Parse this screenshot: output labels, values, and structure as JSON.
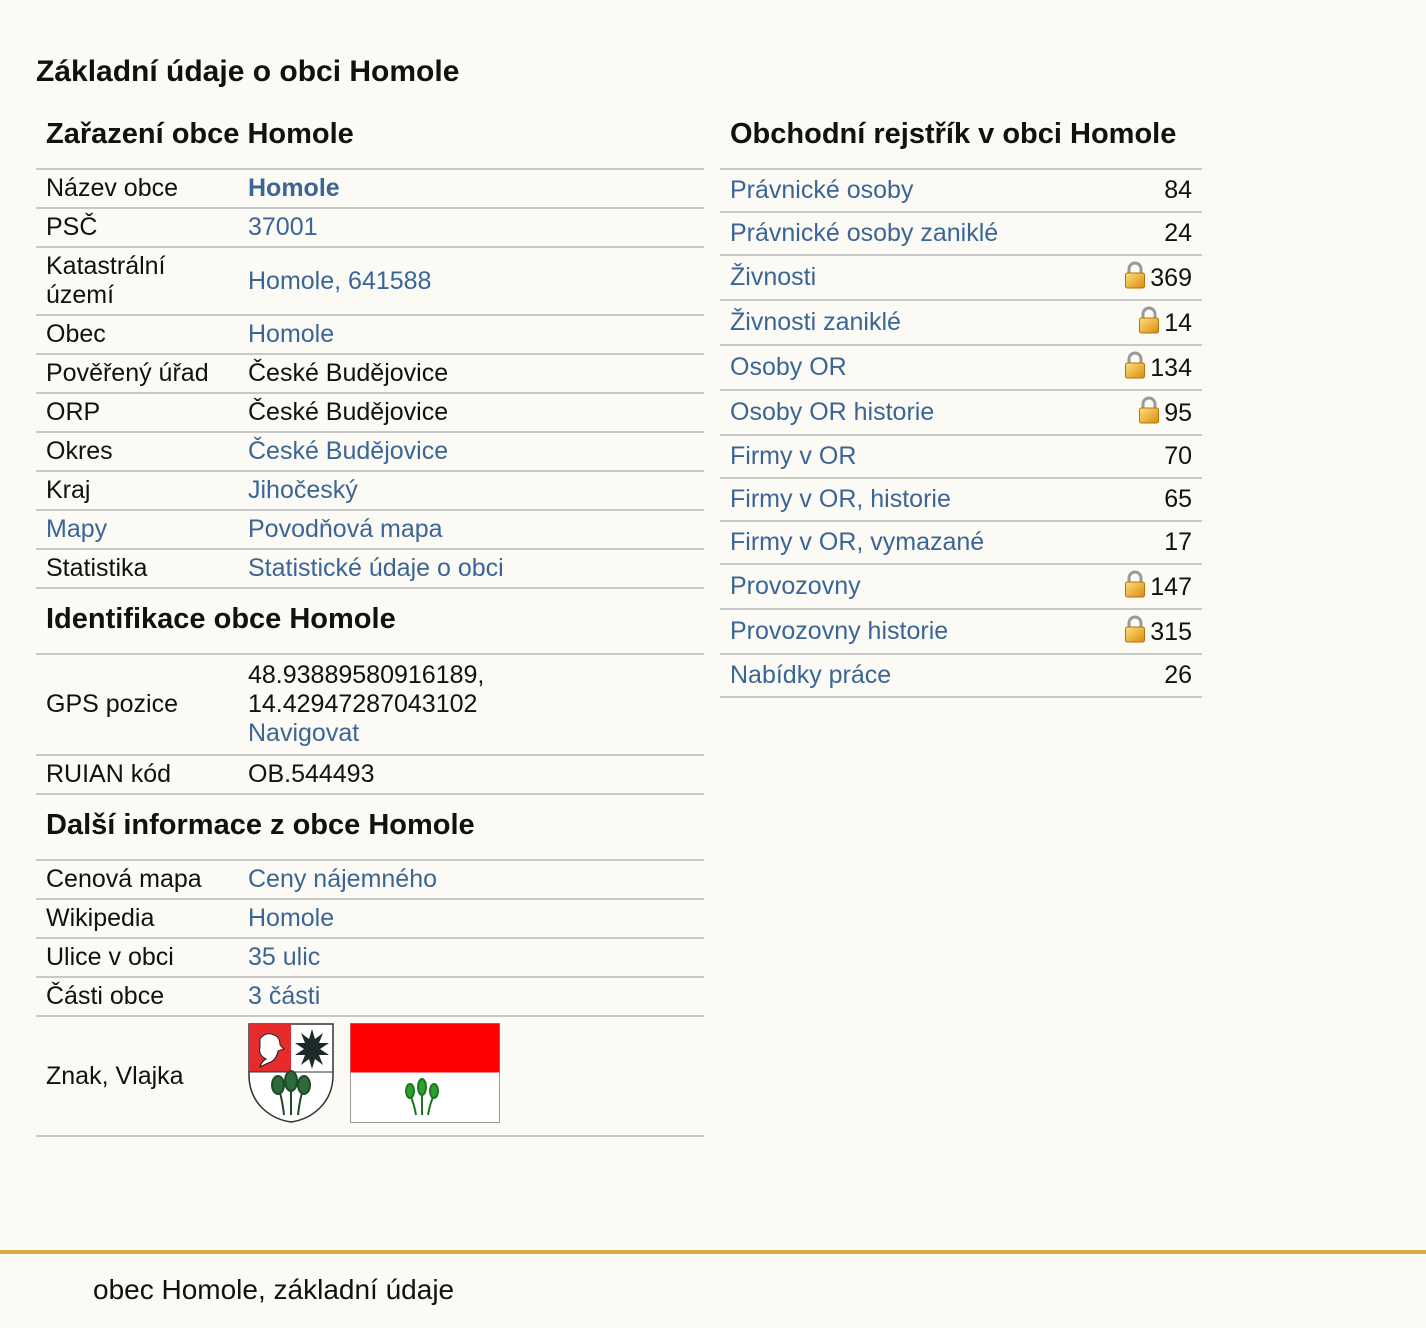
{
  "page_title": "Základní údaje o obci Homole",
  "zarazeni": {
    "heading": "Zařazení obce Homole",
    "rows": [
      {
        "key": "Název obce",
        "value": "Homole"
      },
      {
        "key": "PSČ",
        "value": "37001"
      },
      {
        "key": "Katastrální území",
        "value": "Homole, 641588"
      },
      {
        "key": "Obec",
        "value": "Homole"
      },
      {
        "key": "Pověřený úřad",
        "value": "České Budějovice"
      },
      {
        "key": "ORP",
        "value": "České Budějovice"
      },
      {
        "key": "Okres",
        "value": "České Budějovice"
      },
      {
        "key": "Kraj",
        "value": "Jihočeský"
      },
      {
        "key": "Mapy",
        "value": "Povodňová mapa"
      },
      {
        "key": "Statistika",
        "value": "Statistické údaje o obci"
      }
    ]
  },
  "identifikace": {
    "heading": "Identifikace obce Homole",
    "gps_key": "GPS pozice",
    "gps_lat": "48.93889580916189,",
    "gps_lon": "14.42947287043102",
    "navigate": "Navigovat",
    "ruian_key": "RUIAN kód",
    "ruian_value": "OB.544493"
  },
  "dalsi": {
    "heading": "Další informace z obce Homole",
    "rows": [
      {
        "key": "Cenová mapa",
        "value": "Ceny nájemného"
      },
      {
        "key": "Wikipedia",
        "value": "Homole"
      },
      {
        "key": "Ulice v obci",
        "value": "35 ulic"
      },
      {
        "key": "Části obce",
        "value": "3 části"
      }
    ],
    "emblem_key": "Znak, Vlajka"
  },
  "rejstrik": {
    "heading": "Obchodní rejstřík v obci Homole",
    "rows": [
      {
        "label": "Právnické osoby",
        "count": "84"
      },
      {
        "label": "Právnické osoby zaniklé",
        "count": "24"
      },
      {
        "label": "Živnosti",
        "count": "369"
      },
      {
        "label": "Živnosti zaniklé",
        "count": "14"
      },
      {
        "label": "Osoby OR",
        "count": "134"
      },
      {
        "label": "Osoby OR historie",
        "count": "95"
      },
      {
        "label": "Firmy v OR",
        "count": "70"
      },
      {
        "label": "Firmy v OR, historie",
        "count": "65"
      },
      {
        "label": "Firmy v OR, vymazané",
        "count": "17"
      },
      {
        "label": "Provozovny",
        "count": "147"
      },
      {
        "label": "Provozovny historie",
        "count": "315"
      },
      {
        "label": "Nabídky práce",
        "count": "26"
      }
    ]
  },
  "footer": {
    "text": "obec Homole, základní údaje"
  },
  "colors": {
    "link": "#3a6596",
    "footer_border": "#d2ad3f",
    "flag_red": "#ff0000",
    "background": "#fbfaf4"
  },
  "icons": {
    "lock": "lock-icon",
    "coat_of_arms": "coat-of-arms-icon",
    "flag": "flag-icon"
  }
}
